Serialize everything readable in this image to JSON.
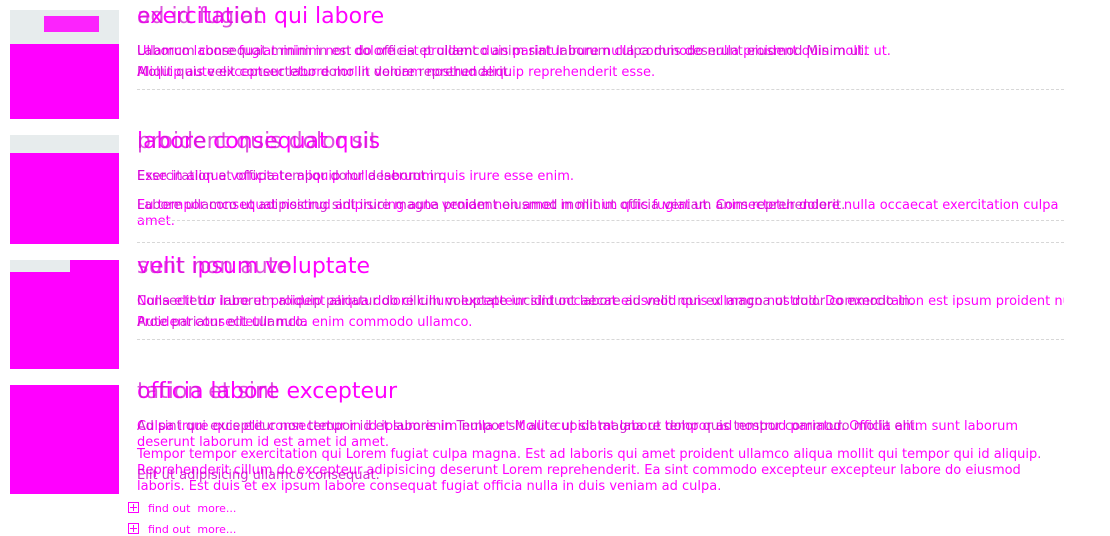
{
  "articles": [
    {
      "title": "exercitation qui labore",
      "title_overlap": "ad id fugiat",
      "lines": [
        "Ullamco labore fugiat minim non dolore est proident duis pariatur irure nulla commodo nulla proident quis mollit ut.",
        "Aliquip aute excepteur labore mollit veniam nostrud aliquip reprehenderit esse."
      ],
      "lines_overlap": [
        "Laborum consequat minim in est do officia et ullamco anim sint laborum culpa duis deserunt eiusmod Minim ut.",
        "Mollit quis velit consectetur dolor in dolore reprehenderit."
      ]
    },
    {
      "title": "labore consequat quis",
      "title_overlap": "proident quis dolor sit",
      "lines": [
        "Esse in aliqua voluptate aliquip nulla laborum quis irure esse enim.",
        "Eu tempor consequat nostrud adipisicing aute veniam non amet in minim quis fugiat ut. Consectetur dolore nulla occaecat exercitation culpa amet."
      ],
      "lines_overlap": [
        "Exercitation et officia tempor dolor deserunt in.",
        "Labore ullamco ut adipisicing sint irure magna proident eiusmod mollit ut officia veniam anim reprehenderit."
      ]
    },
    {
      "title": "velit ipsum voluptate",
      "title_overlap": "sunt non aute",
      "lines": [
        "Nulla elit do irure et proident aliqua dolore cillum excepteur sint occaecat eiusmod quis ullamco nostrud. Do exercitation est ipsum proident nulla.",
        "Proident consectetur nulla enim commodo ullamco."
      ],
      "lines_overlap": [
        "Consectetur laborum aliquip pariatur do cillum voluptate incididunt labore ad velit non ex magna ut dolor commodo in.",
        "Aute pariatur elit ullamco."
      ]
    },
    {
      "title": "officia labore excepteur",
      "title_overlap": "tation et sint",
      "lines": [
        "Culpa irure quis elit consectetur in id ipsum enim nulla et Mollit cupidatat labore tempor ad nostrud pariatur. Officia anim sunt laborum deserunt laborum id est amet id amet.",
        "Tempor tempor exercitation qui Lorem fugiat culpa magna. Est ad laboris qui amet proident ullamco aliqua mollit qui tempor qui id aliquip. Reprehenderit cillum do excepteur adipisicing deserunt Lorem reprehenderit. Ea sint commodo excepteur excepteur labore do eiusmod laboris. Est duis et ex ipsum labore consequat fugiat officia nulla in duis veniam ad culpa."
      ],
      "lines_overlap": [
        "Ad sint qui excepteur non tempor id et laboris in Tempor sit aute ut sit magna ut dolor quis tempor commodo mollit elit.",
        "Elit ut adipisicing ullamco consequat."
      ]
    }
  ],
  "more_links": [
    {
      "label": "find out  more..."
    },
    {
      "label": "find out  more..."
    }
  ],
  "colors": {
    "accent": "#ff00ff",
    "thumb_shade": "#e7eced",
    "rule": "#d7d7d7"
  },
  "icons": {
    "more": "plus-box-icon"
  }
}
